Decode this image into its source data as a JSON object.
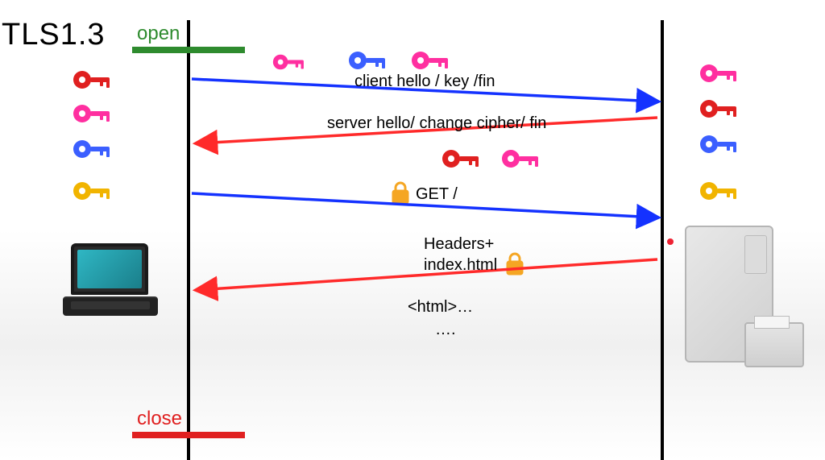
{
  "title": "TLS1.3",
  "markers": {
    "open": "open",
    "close": "close"
  },
  "messages": {
    "m1": "client hello / key /fin",
    "m2": "server hello/ change cipher/ fin",
    "m3": "GET /",
    "m4a": "Headers+",
    "m4b": "index.html",
    "m5": "<html>…",
    "m6": "…."
  },
  "keys": {
    "client": [
      {
        "color": "#e02020"
      },
      {
        "color": "#ff2fa0"
      },
      {
        "color": "#3b5fff"
      },
      {
        "color": "#f1b400"
      }
    ],
    "server": [
      {
        "color": "#ff2fa0"
      },
      {
        "color": "#e02020"
      },
      {
        "color": "#3b5fff"
      },
      {
        "color": "#f1b400"
      }
    ],
    "above_m1": [
      {
        "color": "#ff2fa0"
      },
      {
        "color": "#3b5fff"
      },
      {
        "color": "#ff2fa0"
      }
    ],
    "above_m3": [
      {
        "color": "#e02020"
      },
      {
        "color": "#ff2fa0"
      }
    ]
  },
  "arrows": {
    "blue": "#1432ff",
    "red": "#ff2a2a"
  },
  "lock_color": "#f5a623"
}
